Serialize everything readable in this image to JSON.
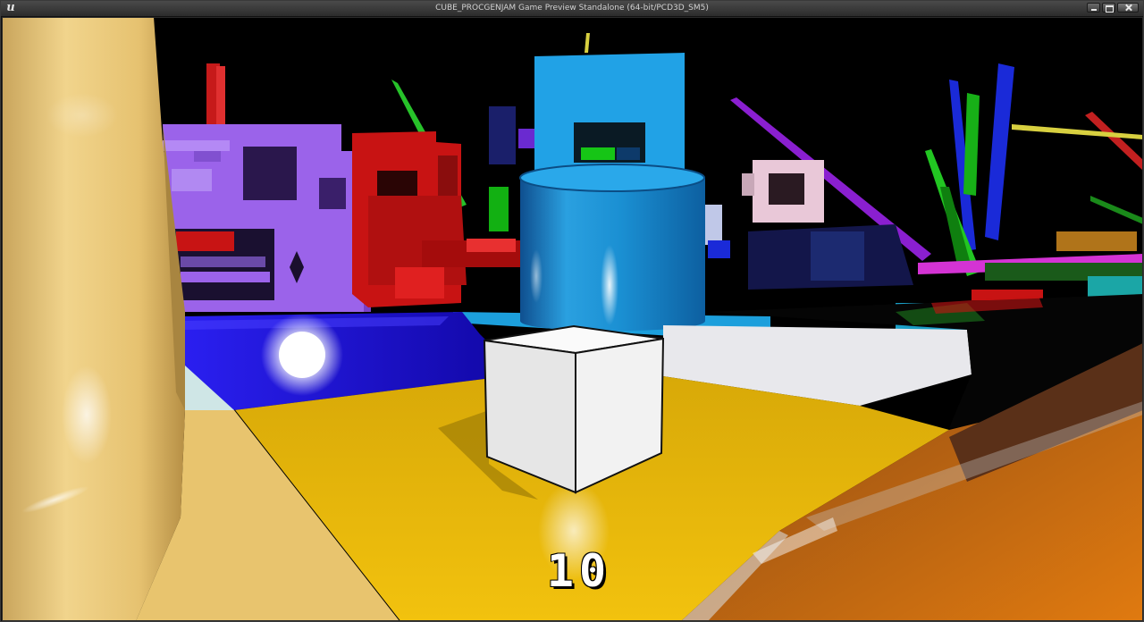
{
  "window": {
    "title": "CUBE_PROCGENJAM Game Preview Standalone (64-bit/PCD3D_SM5)",
    "logo_glyph": "u",
    "controls": [
      "minimize-icon",
      "maximize-icon",
      "close-icon"
    ]
  },
  "hud": {
    "score": "10"
  },
  "colors": {
    "floor_yellow": "#e9b80a",
    "floor_blue": "#1f15d6",
    "pillar_tan": "#e6c67a",
    "cylinder_blue": "#1b8fd2",
    "cube_white": "#f1f1f1",
    "purple_building": "#9b63ea",
    "red_building": "#c81313",
    "ramp_orange": "#d1700e"
  }
}
